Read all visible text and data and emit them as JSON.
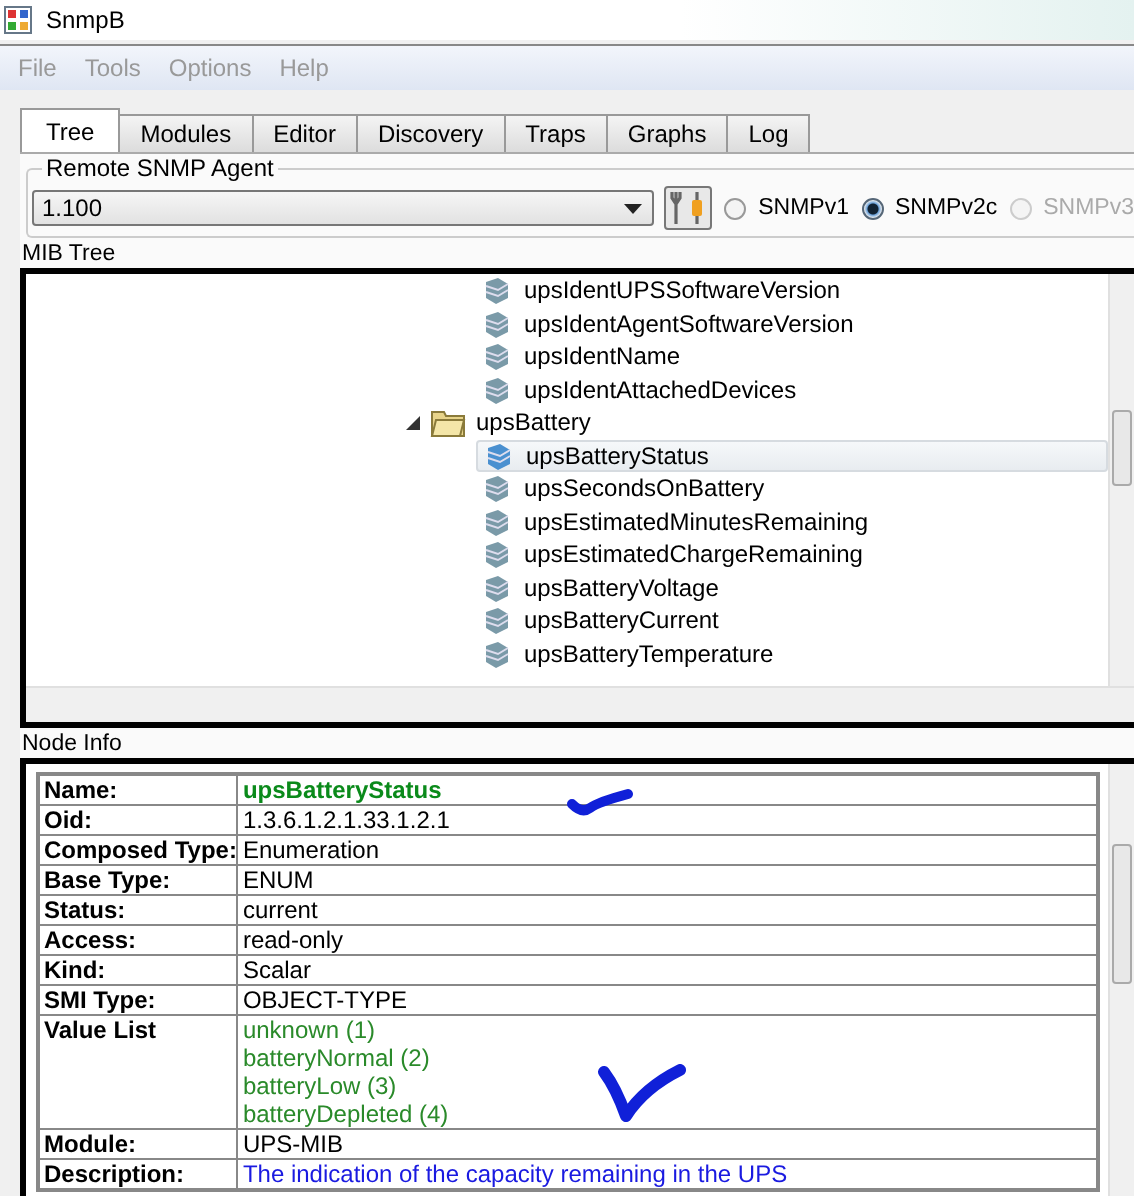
{
  "window": {
    "title": "SnmpB"
  },
  "menu": [
    "File",
    "Tools",
    "Options",
    "Help"
  ],
  "tabs": [
    {
      "label": "Tree",
      "selected": true
    },
    {
      "label": "Modules",
      "selected": false
    },
    {
      "label": "Editor",
      "selected": false
    },
    {
      "label": "Discovery",
      "selected": false
    },
    {
      "label": "Traps",
      "selected": false
    },
    {
      "label": "Graphs",
      "selected": false
    },
    {
      "label": "Log",
      "selected": false
    }
  ],
  "agent": {
    "label": "Remote SNMP Agent",
    "value": "1.100",
    "versions": [
      {
        "label": "SNMPv1",
        "selected": false,
        "disabled": false
      },
      {
        "label": "SNMPv2c",
        "selected": true,
        "disabled": false
      },
      {
        "label": "SNMPv3",
        "selected": false,
        "disabled": true
      }
    ]
  },
  "mib_tree": {
    "label": "MIB Tree",
    "items": [
      {
        "label": "upsIdentUPSSoftwareVersion",
        "kind": "leaf",
        "selected": false
      },
      {
        "label": "upsIdentAgentSoftwareVersion",
        "kind": "leaf",
        "selected": false
      },
      {
        "label": "upsIdentName",
        "kind": "leaf",
        "selected": false
      },
      {
        "label": "upsIdentAttachedDevices",
        "kind": "leaf",
        "selected": false
      },
      {
        "label": "upsBattery",
        "kind": "folder",
        "selected": false,
        "expanded": true,
        "children": [
          {
            "label": "upsBatteryStatus",
            "kind": "leaf",
            "selected": true
          },
          {
            "label": "upsSecondsOnBattery",
            "kind": "leaf",
            "selected": false
          },
          {
            "label": "upsEstimatedMinutesRemaining",
            "kind": "leaf",
            "selected": false
          },
          {
            "label": "upsEstimatedChargeRemaining",
            "kind": "leaf",
            "selected": false
          },
          {
            "label": "upsBatteryVoltage",
            "kind": "leaf",
            "selected": false
          },
          {
            "label": "upsBatteryCurrent",
            "kind": "leaf",
            "selected": false
          },
          {
            "label": "upsBatteryTemperature",
            "kind": "leaf",
            "selected": false
          }
        ]
      }
    ]
  },
  "node_info": {
    "label": "Node Info",
    "rows": [
      {
        "key": "Name:",
        "kind": "name",
        "values": [
          "upsBatteryStatus"
        ]
      },
      {
        "key": "Oid:",
        "kind": "plain",
        "values": [
          "1.3.6.1.2.1.33.1.2.1"
        ]
      },
      {
        "key": "Composed Type:",
        "kind": "plain",
        "values": [
          "Enumeration"
        ]
      },
      {
        "key": "Base Type:",
        "kind": "plain",
        "values": [
          "ENUM"
        ]
      },
      {
        "key": "Status:",
        "kind": "plain",
        "values": [
          "current"
        ]
      },
      {
        "key": "Access:",
        "kind": "plain",
        "values": [
          "read-only"
        ]
      },
      {
        "key": "Kind:",
        "kind": "plain",
        "values": [
          "Scalar"
        ]
      },
      {
        "key": "SMI Type:",
        "kind": "plain",
        "values": [
          "OBJECT-TYPE"
        ]
      },
      {
        "key": "Value List",
        "kind": "enum",
        "values": [
          "unknown (1)",
          "batteryNormal (2)",
          "batteryLow (3)",
          "batteryDepleted (4)"
        ]
      },
      {
        "key": "Module:",
        "kind": "plain",
        "values": [
          "UPS-MIB"
        ]
      },
      {
        "key": "Description:",
        "kind": "description",
        "values": [
          "The indication of the capacity remaining in the UPS"
        ]
      }
    ]
  }
}
